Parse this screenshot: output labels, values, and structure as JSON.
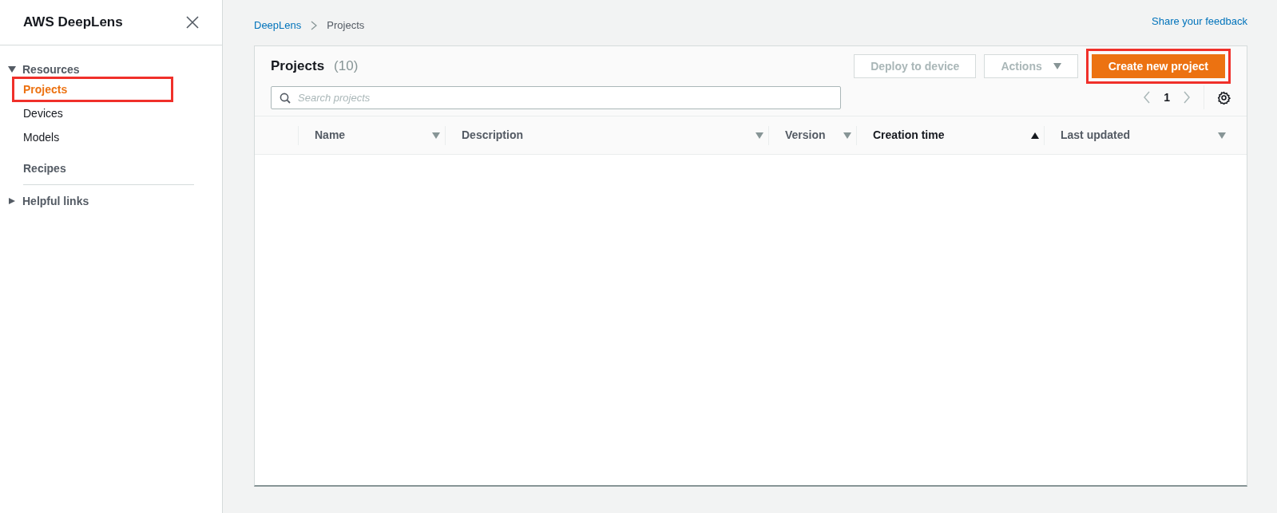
{
  "sidebar": {
    "title": "AWS DeepLens",
    "sections": [
      {
        "label": "Resources",
        "expanded": true,
        "items": [
          {
            "label": "Projects",
            "selected": true,
            "highlighted": true
          },
          {
            "label": "Devices",
            "selected": false,
            "highlighted": false
          },
          {
            "label": "Models",
            "selected": false,
            "highlighted": false
          }
        ]
      }
    ],
    "links": [
      {
        "label": "Recipes"
      }
    ],
    "footer_sections": [
      {
        "label": "Helpful links",
        "expanded": false
      }
    ]
  },
  "breadcrumbs": [
    {
      "label": "DeepLens",
      "kind": "link"
    },
    {
      "label": "Projects",
      "kind": "current"
    }
  ],
  "feedback_link": "Share your feedback",
  "panel": {
    "title": "Projects",
    "count": "(10)",
    "buttons": [
      {
        "label": "Deploy to device",
        "kind": "secondary",
        "disabled": true,
        "highlighted": false
      },
      {
        "label": "Actions",
        "kind": "dropdown",
        "disabled": true,
        "highlighted": false
      },
      {
        "label": "Create new project",
        "kind": "primary",
        "disabled": false,
        "highlighted": true
      }
    ],
    "search": {
      "placeholder": "Search projects"
    },
    "page": "1",
    "table": {
      "columns": [
        {
          "label": "Name",
          "sorted": false
        },
        {
          "label": "Description",
          "sorted": false
        },
        {
          "label": "Version",
          "sorted": false
        },
        {
          "label": "Creation time",
          "sorted": true
        },
        {
          "label": "Last updated",
          "sorted": false
        }
      ]
    }
  }
}
